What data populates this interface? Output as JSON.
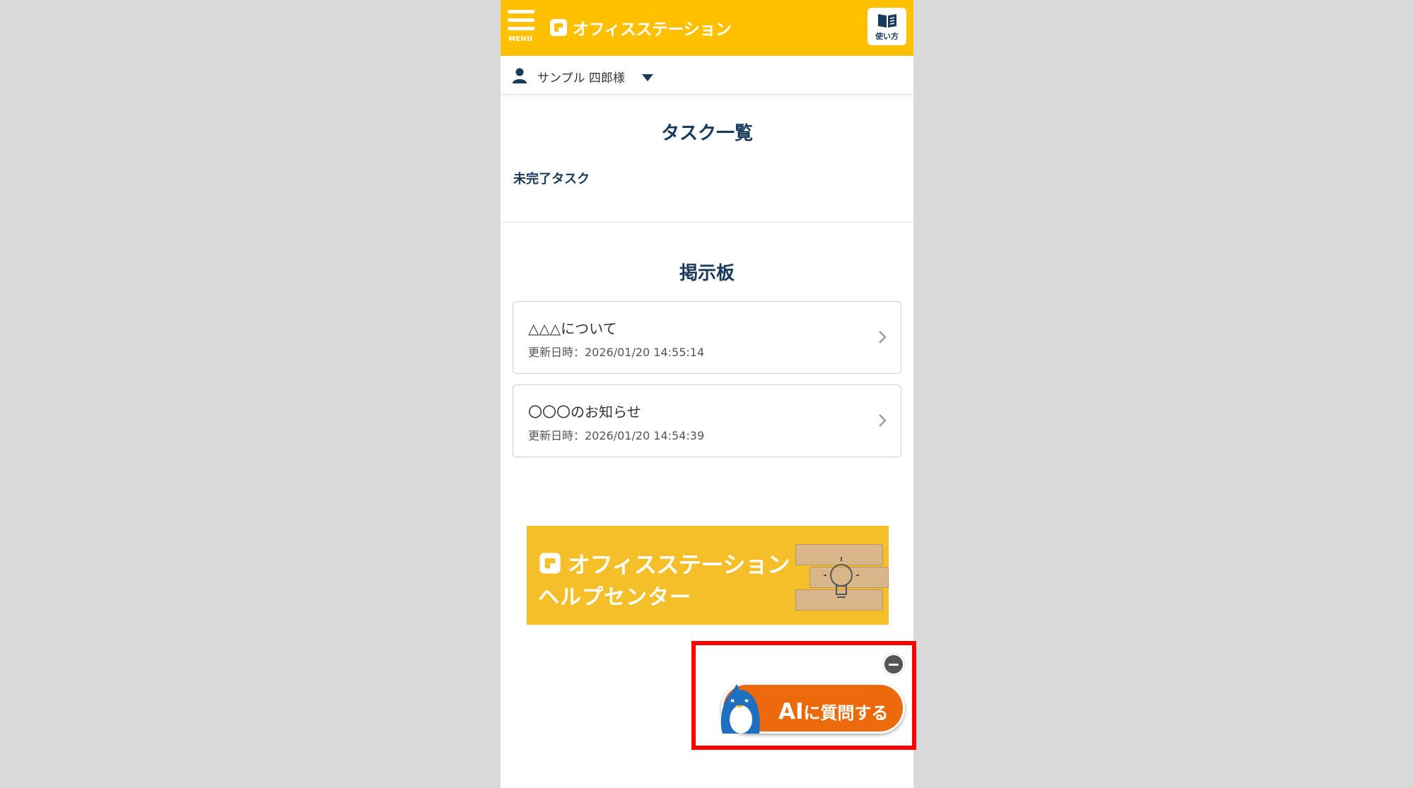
{
  "header": {
    "menu_label": "MENU",
    "app_name": "オフィスステーション",
    "guide_label": "使い方"
  },
  "user": {
    "name": "サンプル 四郎様"
  },
  "tasks": {
    "title": "タスク一覧",
    "subheading": "未完了タスク"
  },
  "board": {
    "title": "掲示板",
    "posts": [
      {
        "title": "△△△について",
        "updated": "更新日時：2026/01/20 14:55:14"
      },
      {
        "title": "〇〇〇のお知らせ",
        "updated": "更新日時：2026/01/20 14:54:39"
      }
    ]
  },
  "banner": {
    "title": "オフィスステーション",
    "subtitle": "ヘルプセンター"
  },
  "ai_button": {
    "label_main": "AI",
    "label_rest": "に質問する"
  },
  "colors": {
    "brand_yellow": "#ffc000",
    "navy": "#1a3a5c",
    "ai_orange": "#ec6a0c",
    "highlight_red": "#ff0000"
  },
  "icons": {
    "menu": "hamburger-icon",
    "guide": "book-icon",
    "user": "person-icon",
    "dropdown": "caret-down-icon",
    "chevron": "chevron-right-icon",
    "close": "minus-circle-icon",
    "mascot": "penguin-mascot-icon"
  }
}
